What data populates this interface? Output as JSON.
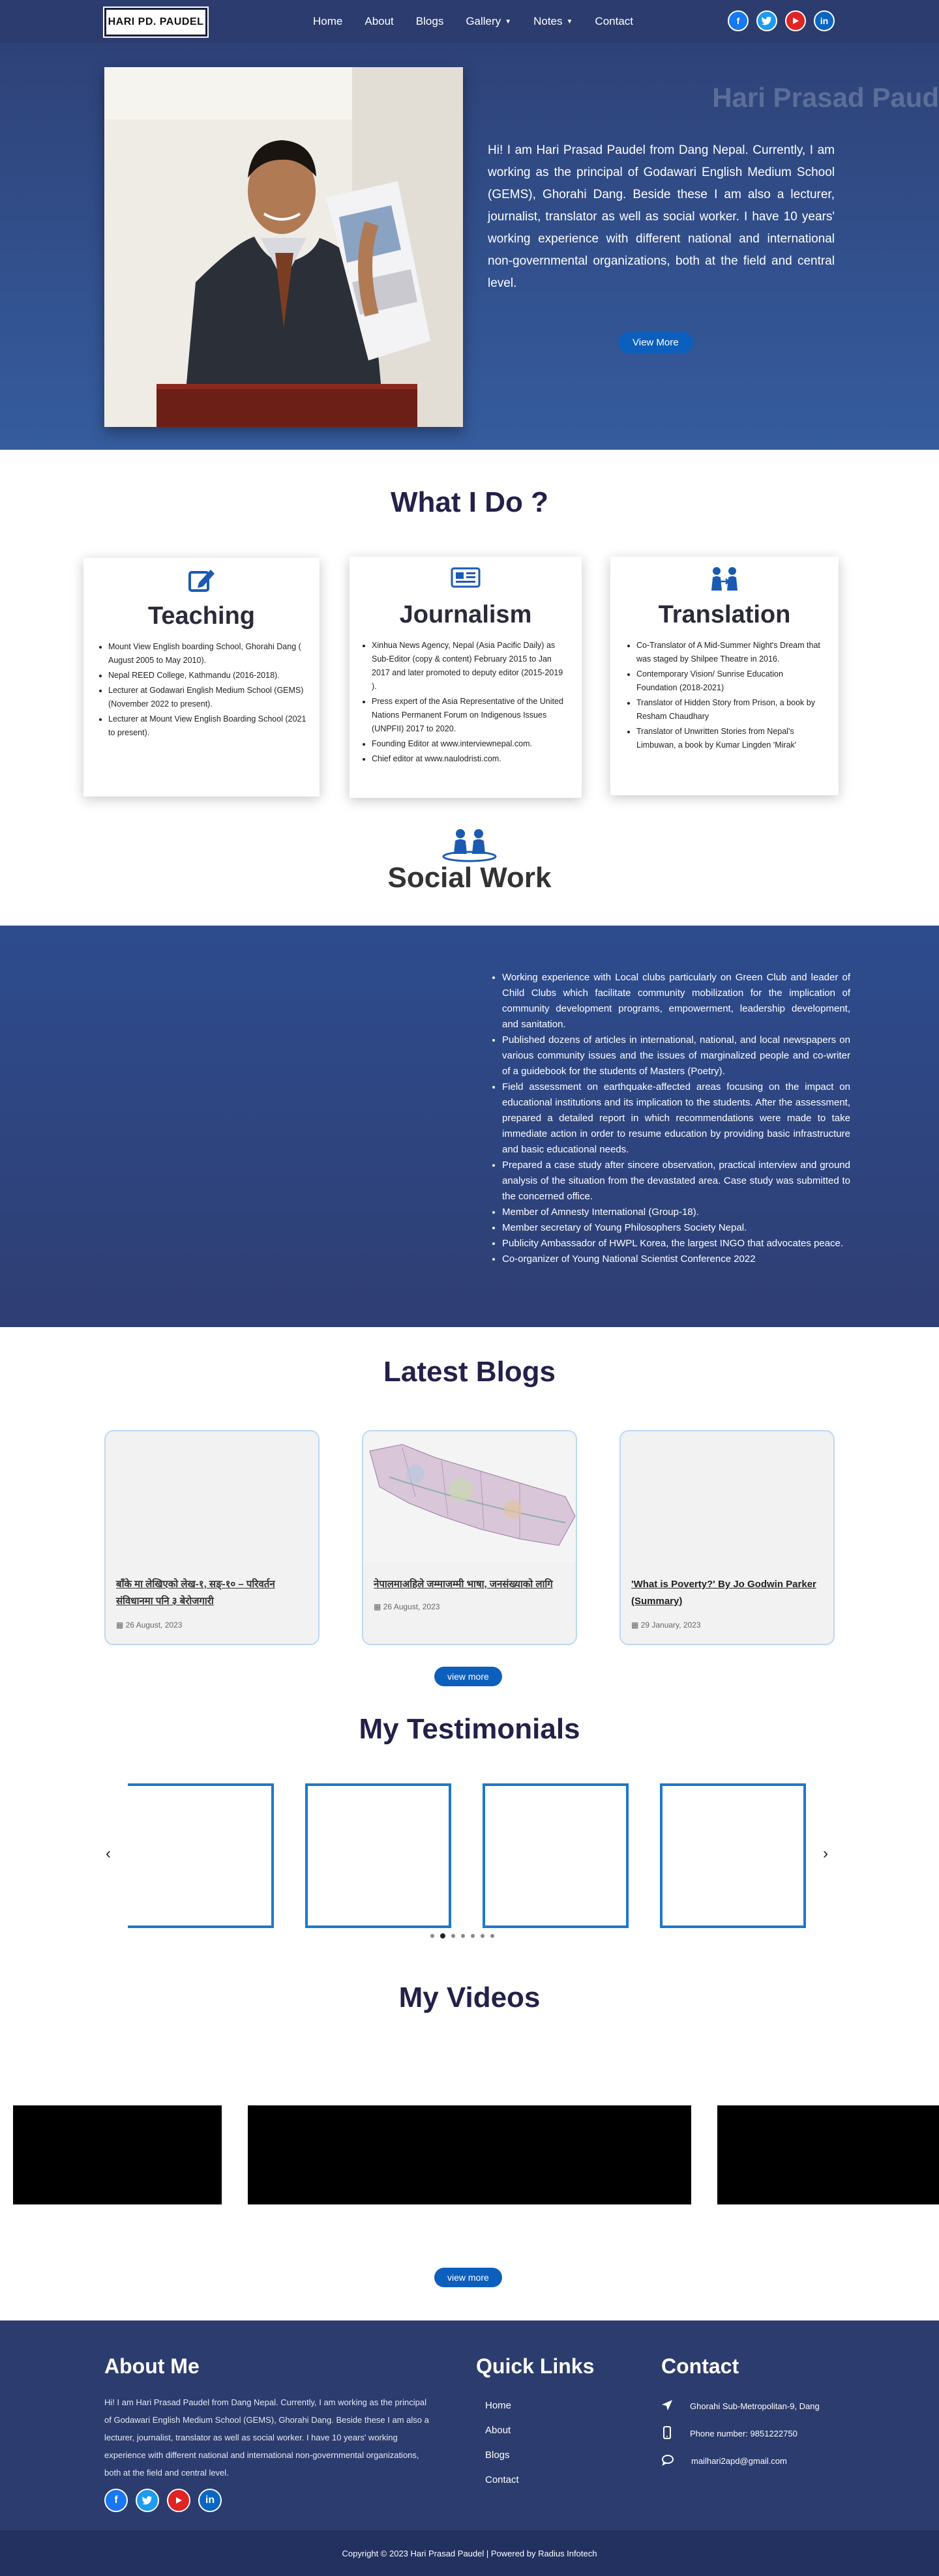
{
  "nav": {
    "logo": "HARI PD. PAUDEL",
    "items": [
      {
        "label": "Home"
      },
      {
        "label": "About"
      },
      {
        "label": "Blogs"
      },
      {
        "label": "Gallery"
      },
      {
        "label": "Notes"
      },
      {
        "label": "Contact"
      }
    ],
    "social": [
      "facebook-icon",
      "twitter-icon",
      "youtube-icon",
      "linkedin-icon"
    ]
  },
  "hero": {
    "name_watermark": "Hari Prasad Paud",
    "intro": "Hi! I am Hari Prasad Paudel from Dang Nepal. Currently, I am working as the principal of Godawari English Medium School (GEMS), Ghorahi Dang. Beside these I am also a lecturer, journalist, translator as well as social worker. I have 10 years' working experience with different national and international non-governmental organizations, both at the field and central level.",
    "button": "View More"
  },
  "what_i_do": {
    "title": "What I Do ?",
    "cards": [
      {
        "title": "Teaching",
        "items": [
          "Mount View English boarding School, Ghorahi Dang ( August 2005 to May 2010).",
          "Nepal REED College, Kathmandu (2016-2018).",
          "Lecturer at Godawari English Medium School (GEMS) (November 2022 to present).",
          "Lecturer at Mount View English Boarding School (2021 to present)."
        ]
      },
      {
        "title": "Journalism",
        "items": [
          "Xinhua News Agency, Nepal (Asia Pacific Daily) as Sub-Editor (copy & content) February 2015 to Jan 2017 and later promoted to deputy editor (2015-2019 ).",
          "Press expert of the Asia Representative of the United Nations Permanent Forum on Indigenous Issues (UNPFII) 2017 to 2020.",
          "Founding Editor at www.interviewnepal.com.",
          "Chief editor at www.naulodristi.com."
        ]
      },
      {
        "title": "Translation",
        "items": [
          "Co-Translator of A Mid-Summer Night's Dream that was staged by Shilpee Theatre in 2016.",
          "Contemporary Vision/ Sunrise Education Foundation (2018-2021)",
          "Translator of Hidden Story from Prison, a book by Resham Chaudhary",
          "Translator of Unwritten Stories from Nepal's Limbuwan, a book by Kumar Lingden 'Mirak'"
        ]
      }
    ]
  },
  "social_work": {
    "title": "Social Work",
    "items": [
      "Working experience with Local clubs particularly on Green Club and leader of Child Clubs which facilitate community mobilization for the implication of community development programs, empowerment, leadership development, and sanitation.",
      "Published dozens of articles in international, national, and local newspapers on various community issues and the issues of marginalized people and co-writer of a guidebook for the students of Masters (Poetry).",
      "Field assessment on earthquake-affected areas focusing on the impact on educational institutions and its implication to the students. After the assessment, prepared a detailed report in which recommendations were made to take immediate action in order to resume education by providing basic infrastructure and basic educational needs.",
      "Prepared a case study after sincere observation, practical interview and ground analysis of the situation from the devastated area. Case study was submitted to the concerned office.",
      "Member of Amnesty International (Group-18).",
      "Member secretary of Young Philosophers Society Nepal.",
      "Publicity Ambassador of HWPL Korea, the largest INGO that advocates peace.",
      "Co-organizer of Young National Scientist Conference 2022"
    ]
  },
  "blogs": {
    "title": "Latest Blogs",
    "posts": [
      {
        "title": "बाँके मा लेखिएको लेख-१, सङ्-१० – परिवर्तन संविधानमा पनि ३ बेरोजगारी",
        "date": "26 August, 2023"
      },
      {
        "title": "नेपालमाअहिले जम्माजम्मी भाषा, जनसंख्याको लागि",
        "date": "26 August, 2023"
      },
      {
        "title": "'What is Poverty?' By Jo Godwin Parker (Summary)",
        "date": "29 January, 2023"
      }
    ],
    "button": "view more"
  },
  "testimonials": {
    "title": "My Testimonials",
    "dots": 7
  },
  "videos": {
    "title": "My Videos",
    "button": "view more"
  },
  "footer": {
    "about_title": "About Me",
    "about_text": "Hi! I am Hari Prasad Paudel from Dang Nepal. Currently, I am working as the principal of Godawari English Medium School (GEMS), Ghorahi Dang. Beside these I am also a lecturer, journalist, translator as well as social worker. I have 10 years' working experience with different national and international non-governmental organizations, both at the field and central level.",
    "links_title": "Quick Links",
    "links": [
      "Home",
      "About",
      "Blogs",
      "Contact"
    ],
    "contact_title": "Contact",
    "address": "Ghorahi Sub-Metropolitan-9, Dang",
    "phone": "Phone number: 9851222750",
    "email": "mailhari2apd@gmail.com",
    "copyright": "Copyright © 2023 Hari Prasad Paudel | Powered by Radius Infotech"
  },
  "colors": {
    "nav": "#2c3c6e",
    "accent": "#0d5fbd",
    "heading": "#23204a"
  }
}
